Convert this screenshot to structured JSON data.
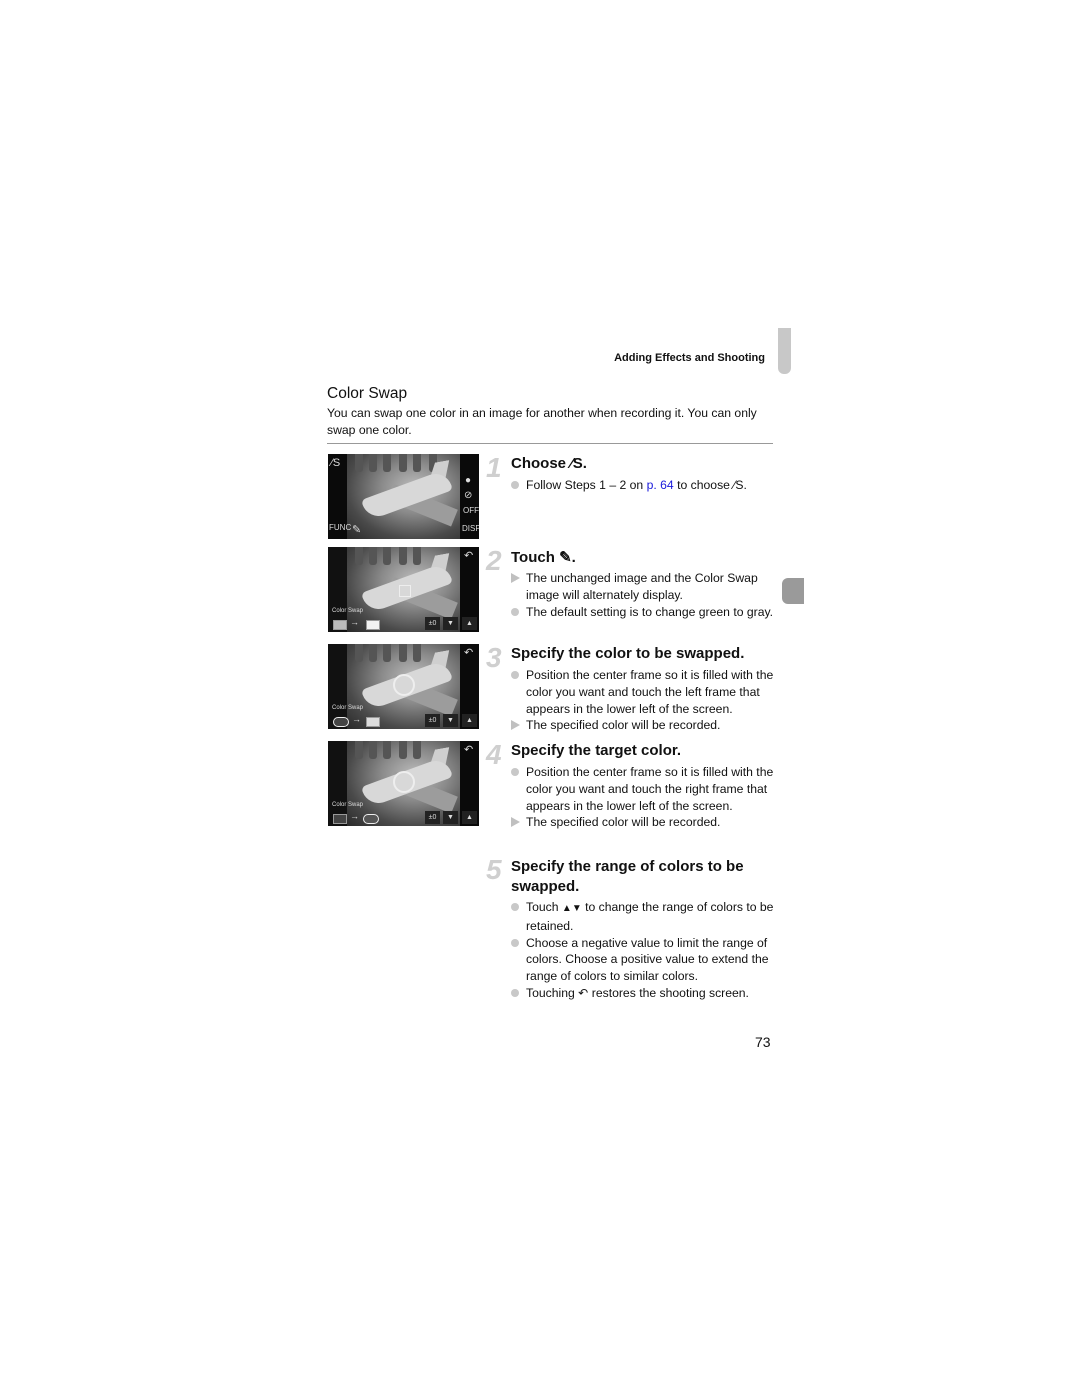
{
  "header": {
    "running_head": "Adding Effects and Shooting",
    "page_number": "73"
  },
  "section": {
    "title": "Color Swap",
    "intro": "You can swap one color in an image for another when recording it. You can only swap one color."
  },
  "screens": [
    {
      "type": "shooting",
      "left_icons": [
        "color-swap-mode-icon",
        "FUNC"
      ],
      "right_icons": [
        "record-icon",
        "flash-off-icon",
        "self-timer-off-icon",
        "DISP"
      ],
      "center_icon": "eyedropper-icon"
    },
    {
      "type": "color-swap",
      "label": "Color Swap",
      "value": "±0",
      "selected_frame": "none"
    },
    {
      "type": "color-swap",
      "label": "Color Swap",
      "value": "±0",
      "selected_frame": "left"
    },
    {
      "type": "color-swap",
      "label": "Color Swap",
      "value": "±0",
      "selected_frame": "right"
    }
  ],
  "steps": [
    {
      "number": "1",
      "title": "Choose",
      "title_suffix": ".",
      "bullets": [
        {
          "marker": "dot",
          "pre": "Follow Steps 1 – 2 on ",
          "link": "p. 64",
          "post": " to choose ",
          "post2": "."
        }
      ]
    },
    {
      "number": "2",
      "title": "Touch",
      "title_suffix": ".",
      "bullets": [
        {
          "marker": "triangle",
          "text": "The unchanged image and the Color Swap image will alternately display."
        },
        {
          "marker": "dot",
          "text": "The default setting is to change green to gray."
        }
      ]
    },
    {
      "number": "3",
      "title": "Specify the color to be swapped.",
      "bullets": [
        {
          "marker": "dot",
          "text": "Position the center frame so it is filled with the color you want and touch the left frame that appears in the lower left of the screen."
        },
        {
          "marker": "triangle",
          "text": "The specified color will be recorded."
        }
      ]
    },
    {
      "number": "4",
      "title": "Specify the target color.",
      "bullets": [
        {
          "marker": "dot",
          "text": "Position the center frame so it is filled with the color you want and touch the right frame that appears in the lower left of the screen."
        },
        {
          "marker": "triangle",
          "text": "The specified color will be recorded."
        }
      ]
    },
    {
      "number": "5",
      "title": "Specify the range of colors to be swapped.",
      "bullets": [
        {
          "marker": "dot",
          "pre": "Touch ",
          "post": " to change the range of colors to be retained."
        },
        {
          "marker": "dot",
          "text": "Choose a negative value to limit the range of colors. Choose a positive value to extend the range of colors to similar colors."
        },
        {
          "marker": "dot",
          "pre": "Touching ",
          "post": " restores the shooting screen."
        }
      ]
    }
  ],
  "colors": {
    "link": "#1a1adb",
    "step_number": "#cfcfcf",
    "marker": "#c0c0c0",
    "tab_light": "#c8c8c8",
    "tab_dark": "#9a9a9a"
  }
}
